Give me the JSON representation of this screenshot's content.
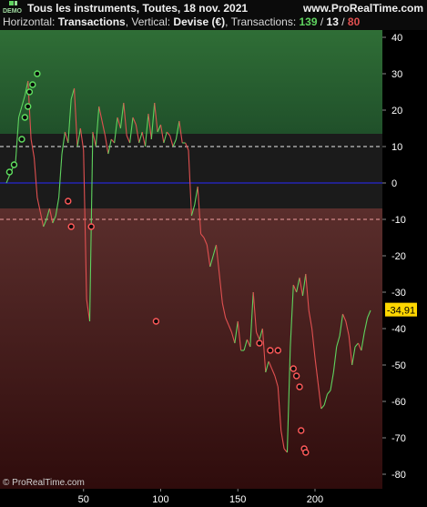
{
  "header": {
    "logo_text": "DEMO",
    "title": "Tous les instruments, Toutes, 18 nov. 2021",
    "site": "www.ProRealTime.com",
    "info_prefix": "Horizontal: ",
    "info_h": "Transactions",
    "info_mid": ", Vertical: ",
    "info_v": "Devise (€)",
    "info_tx": ", Transactions: ",
    "count_total": "139",
    "sep1": " / ",
    "count_win": "13",
    "sep2": " / ",
    "count_loss": "80"
  },
  "watermark": "© ProRealTime.com",
  "colors": {
    "gain": "#5fd35f",
    "loss": "#e05050",
    "zero_line": "#2a2aff",
    "last_label_bg": "#ffd700"
  },
  "chart_data": {
    "type": "line",
    "title": "",
    "xlabel": "",
    "ylabel": "",
    "xlim": [
      0,
      236
    ],
    "ylim": [
      -84,
      42
    ],
    "x_ticks": [
      50,
      100,
      150,
      200
    ],
    "y_ticks": [
      40,
      30,
      20,
      10,
      0,
      -10,
      -20,
      -30,
      -40,
      -50,
      -60,
      -70,
      -80
    ],
    "zones": {
      "upper": 10,
      "lower": -10
    },
    "last_value_label": "-34,91",
    "last_value": -34.91,
    "series": [
      {
        "x": [
          0,
          2,
          4,
          6,
          8,
          10,
          12,
          14,
          16,
          18,
          20,
          22,
          24,
          26,
          28,
          30,
          32,
          34,
          36,
          38,
          40,
          42,
          44,
          46,
          48,
          50,
          52,
          54,
          56,
          58,
          60,
          62,
          64,
          66,
          68,
          70,
          72,
          74,
          76,
          78,
          80,
          82,
          84,
          86,
          88,
          90,
          92,
          94,
          96,
          98,
          100,
          102,
          104,
          106,
          108,
          110,
          112,
          114,
          116,
          118,
          120,
          122,
          124,
          126,
          128,
          130,
          132,
          134,
          136,
          138,
          140,
          142,
          144,
          146,
          148,
          150,
          152,
          154,
          156,
          158,
          160,
          162,
          164,
          166,
          168,
          170,
          172,
          174,
          176,
          178,
          180,
          182,
          184,
          186,
          188,
          190,
          192,
          194,
          196,
          198,
          200,
          202,
          204,
          206,
          208,
          210,
          212,
          214,
          216,
          218,
          220,
          222,
          224,
          226,
          228,
          230,
          232,
          234,
          236
        ],
        "y": [
          0,
          2,
          4,
          6,
          18,
          21,
          24,
          28,
          12,
          7,
          -4,
          -8,
          -12,
          -10,
          -7,
          -11,
          -9,
          -4,
          8,
          14,
          11,
          23,
          26,
          10,
          15,
          9,
          -32,
          -38,
          14,
          10,
          21,
          17,
          13,
          8,
          12,
          11,
          18,
          15,
          22,
          13,
          11,
          18,
          16,
          11,
          14,
          10,
          19,
          12,
          22,
          14,
          16,
          11,
          14,
          13,
          10,
          12,
          17,
          11,
          11,
          9,
          -9,
          -6,
          -1,
          -14,
          -15,
          -17,
          -23,
          -20,
          -17,
          -25,
          -33,
          -37,
          -39,
          -41,
          -44,
          -38,
          -46,
          -46,
          -43,
          -45,
          -30,
          -41,
          -43,
          -40,
          -52,
          -49,
          -51,
          -53,
          -56,
          -68,
          -73,
          -74,
          -45,
          -28,
          -30,
          -26,
          -31,
          -25,
          -35,
          -40,
          -48,
          -55,
          -62,
          -61,
          -58,
          -57,
          -52,
          -45,
          -42,
          -36,
          -38,
          -42,
          -50,
          -45,
          -44,
          -46,
          -41,
          -37,
          -35
        ]
      }
    ],
    "trade_points": [
      {
        "x": 2,
        "y": 3
      },
      {
        "x": 5,
        "y": 5
      },
      {
        "x": 10,
        "y": 12
      },
      {
        "x": 12,
        "y": 18
      },
      {
        "x": 14,
        "y": 21
      },
      {
        "x": 15,
        "y": 25
      },
      {
        "x": 17,
        "y": 27
      },
      {
        "x": 20,
        "y": 30
      },
      {
        "x": 40,
        "y": -5
      },
      {
        "x": 42,
        "y": -12
      },
      {
        "x": 55,
        "y": -12
      },
      {
        "x": 97,
        "y": -38
      },
      {
        "x": 164,
        "y": -44
      },
      {
        "x": 171,
        "y": -46
      },
      {
        "x": 176,
        "y": -46
      },
      {
        "x": 186,
        "y": -51
      },
      {
        "x": 188,
        "y": -53
      },
      {
        "x": 190,
        "y": -56
      },
      {
        "x": 191,
        "y": -68
      },
      {
        "x": 193,
        "y": -73
      },
      {
        "x": 194,
        "y": -74
      }
    ]
  }
}
